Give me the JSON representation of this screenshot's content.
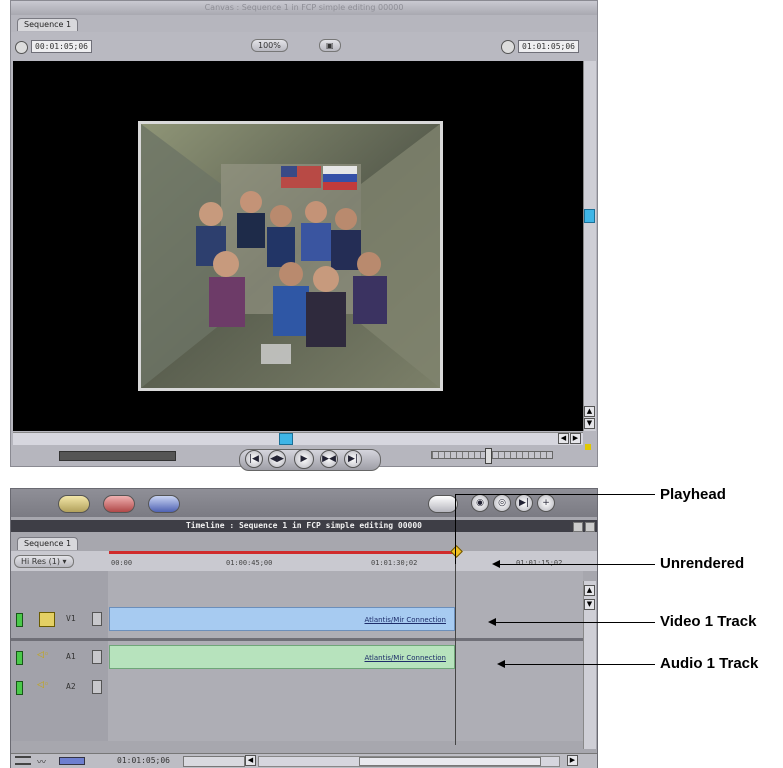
{
  "canvas": {
    "title": "Canvas : Sequence 1 in FCP simple editing 00000",
    "tab": "Sequence 1",
    "duration_tc": "00:01:05;06",
    "zoom": "100%",
    "view": "▣",
    "current_tc": "01:01:05;06"
  },
  "controls": {
    "button_icons": [
      "mark-in-icon",
      "mark-out-icon",
      "play-in-out-icon",
      "play-icon",
      "play-around-icon",
      "next-edit-icon"
    ]
  },
  "timeline": {
    "title": "Timeline : Sequence 1 in FCP simple editing 00000",
    "tab": "Sequence 1",
    "zoom_popup": "Hi Res (1) ▾",
    "ruler_labels": [
      "00:00",
      "01:00:45;00",
      "01:01:30;02",
      "01:01:15;02"
    ],
    "tracks": {
      "v1": {
        "name": "V1",
        "clip": "Atlantis/Mir Connection"
      },
      "a1": {
        "name": "A1",
        "clip": "Atlantis/Mir Connection"
      },
      "a2": {
        "name": "A2"
      }
    },
    "current_tc": "01:01:05;06"
  },
  "annotations": {
    "playhead": "Playhead",
    "unrendered": "Unrendered",
    "video_track": "Video 1 Track",
    "audio_track": "Audio 1 Track"
  }
}
